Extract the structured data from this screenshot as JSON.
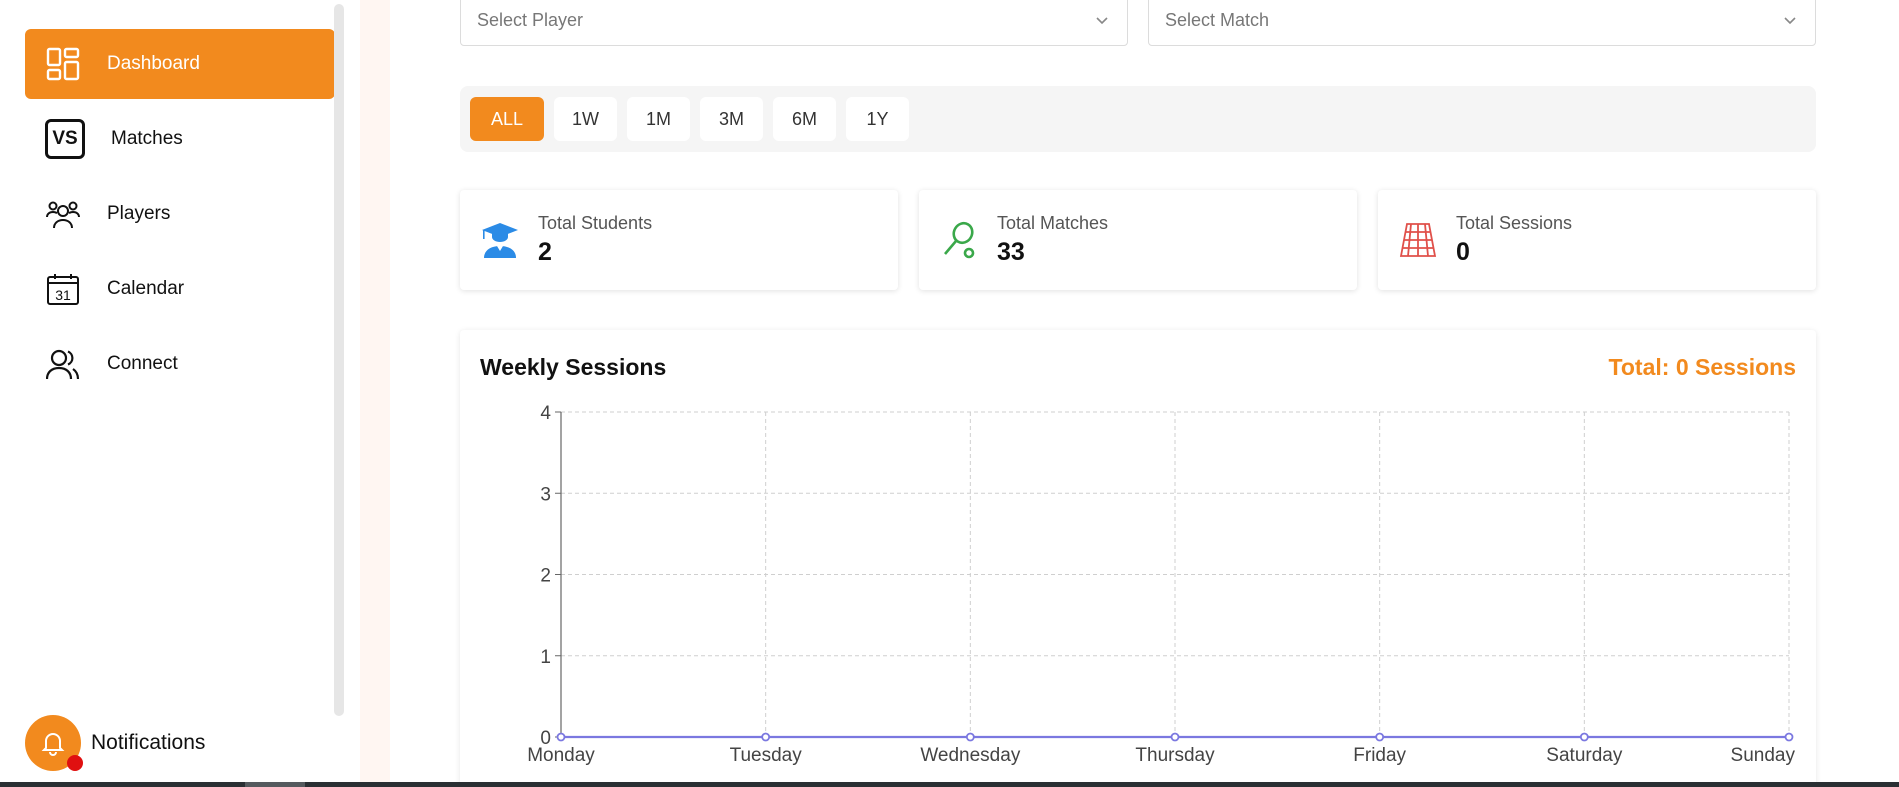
{
  "sidebar": {
    "items": [
      {
        "label": "Dashboard",
        "icon": "dashboard-icon"
      },
      {
        "label": "Matches",
        "icon": "vs-icon",
        "icon_text": "VS"
      },
      {
        "label": "Players",
        "icon": "players-icon"
      },
      {
        "label": "Calendar",
        "icon": "calendar-icon",
        "icon_text": "31"
      },
      {
        "label": "Connect",
        "icon": "connect-icon"
      }
    ],
    "notifications_label": "Notifications"
  },
  "filters": {
    "player_placeholder": "Select Player",
    "match_placeholder": "Select Match",
    "ranges": [
      "ALL",
      "1W",
      "1M",
      "3M",
      "6M",
      "1Y"
    ],
    "active_range": "ALL"
  },
  "stats": [
    {
      "label": "Total Students",
      "value": "2",
      "icon": "graduate-icon",
      "color": "#2b8be6"
    },
    {
      "label": "Total Matches",
      "value": "33",
      "icon": "tennis-racket-icon",
      "color": "#3aa84a"
    },
    {
      "label": "Total Sessions",
      "value": "0",
      "icon": "tennis-court-icon",
      "color": "#e0504a"
    }
  ],
  "chart": {
    "title": "Weekly Sessions",
    "total_label": "Total: 0 Sessions"
  },
  "colors": {
    "accent": "#f28a1e",
    "line": "#7b78e0"
  },
  "chart_data": {
    "type": "line",
    "title": "Weekly Sessions",
    "categories": [
      "Monday",
      "Tuesday",
      "Wednesday",
      "Thursday",
      "Friday",
      "Saturday",
      "Sunday"
    ],
    "series": [
      {
        "values": [
          0,
          0,
          0,
          0,
          0,
          0,
          0
        ]
      }
    ],
    "ylim": [
      0,
      4
    ],
    "yticks": [
      0,
      1,
      2,
      3,
      4
    ],
    "grid": true,
    "xlabel": "",
    "ylabel": ""
  }
}
